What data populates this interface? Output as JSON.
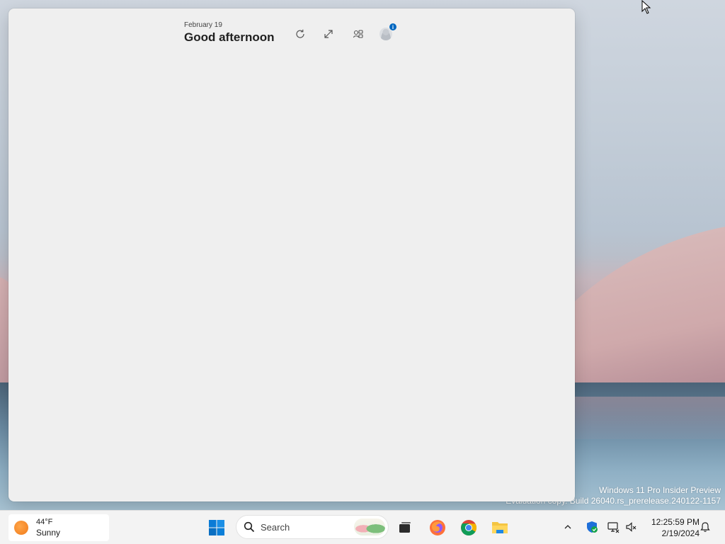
{
  "desktop": {
    "watermark_line1": "Windows 11 Pro Insider Preview",
    "watermark_line2": "Evaluation copy. Build 26040.rs_prerelease.240122-1157"
  },
  "widgets": {
    "date": "February 19",
    "greeting": "Good afternoon",
    "profile_badge": "i",
    "buttons": {
      "refresh_icon": "refresh-icon",
      "expand_icon": "expand-icon",
      "settings_icon": "widgets-settings-icon",
      "profile_icon": "profile-icon"
    }
  },
  "taskbar": {
    "weather": {
      "temp": "44°F",
      "condition": "Sunny",
      "icon": "sun-icon"
    },
    "search_label": "Search",
    "apps": [
      "start-icon",
      "task-view-icon",
      "firefox-icon",
      "chrome-icon",
      "file-explorer-icon"
    ],
    "tray": {
      "icons": [
        "chevron-up-icon",
        "defender-icon",
        "network-icon",
        "volume-icon",
        "notification-bell-icon"
      ],
      "time": "12:25:59 PM",
      "date": "2/19/2024"
    }
  },
  "colors": {
    "accent": "#0067c0",
    "panel_bg": "#efefef",
    "taskbar_bg": "#f3f3f3"
  }
}
